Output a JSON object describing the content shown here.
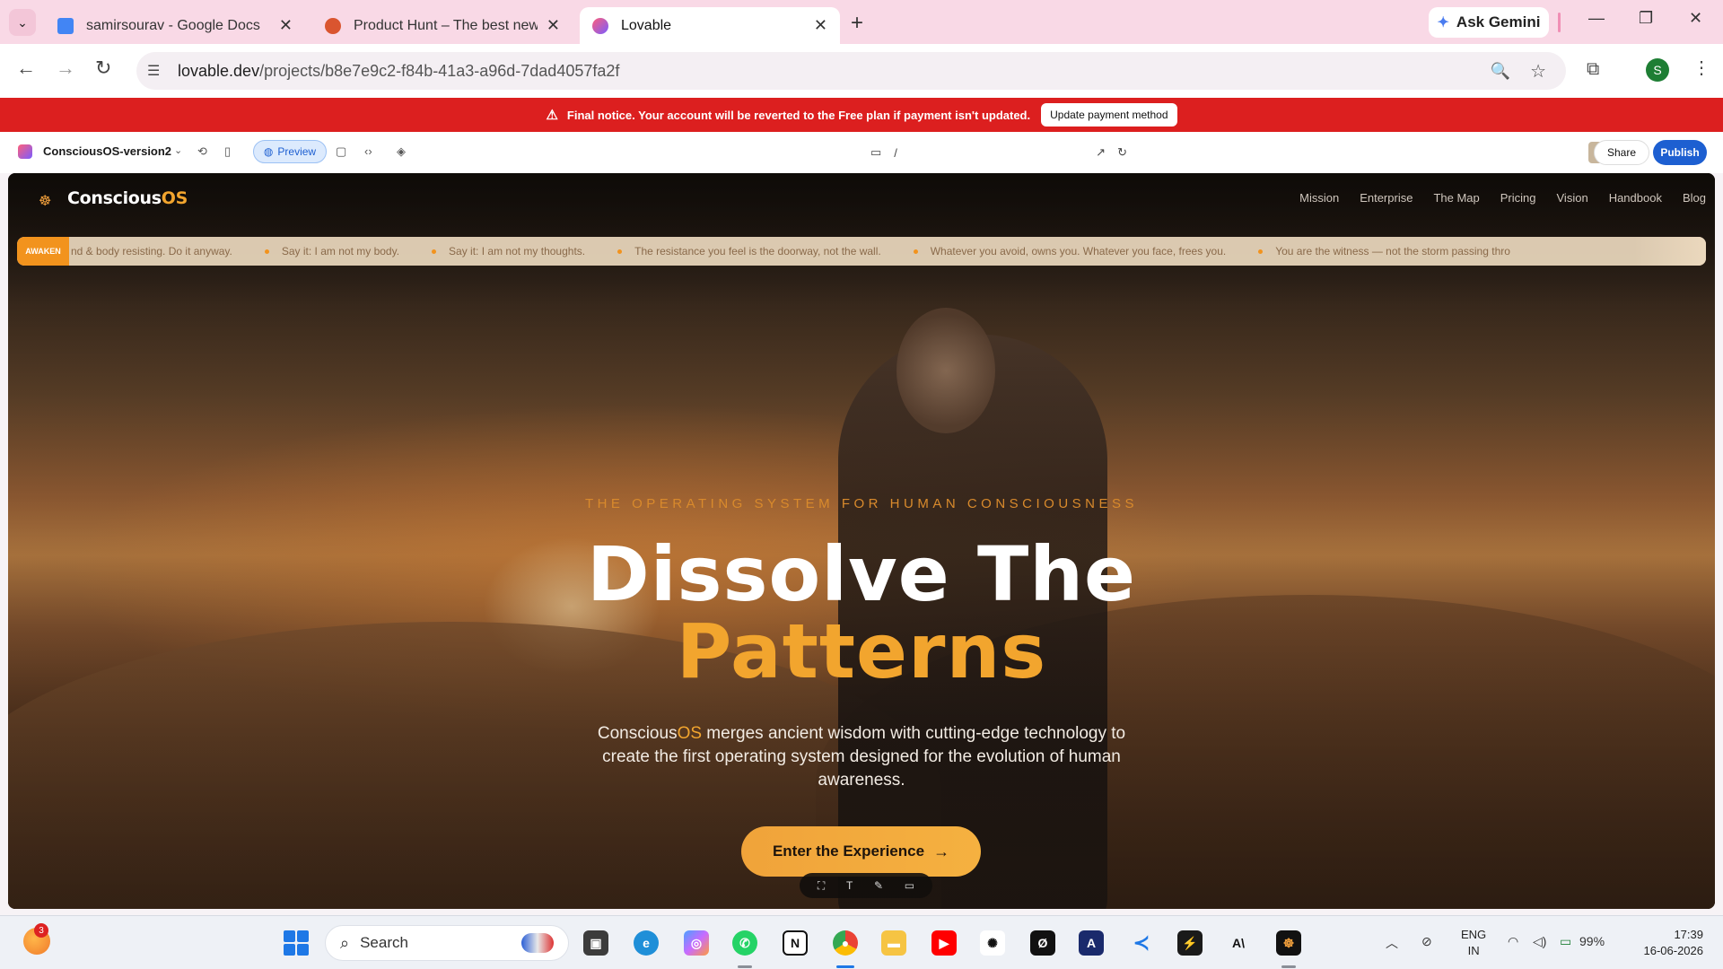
{
  "browser": {
    "tabs": [
      {
        "title": "samirsourav - Google Docs",
        "color": "#4285f4",
        "active": false
      },
      {
        "title": "Product Hunt – The best new p",
        "color": "#da552f",
        "active": false
      },
      {
        "title": "Lovable",
        "color": "#ff5f7a",
        "active": true
      }
    ],
    "new_tab": "+",
    "gemini_label": "Ask Gemini",
    "url_domain": "lovable.dev",
    "url_path": "/projects/b8e7e9c2-f84b-41a3-a96d-7dad4057fa2f",
    "profile_initial": "S"
  },
  "notice": {
    "text": "Final notice. Your account will be reverted to the Free plan if payment isn't updated.",
    "button": "Update payment method",
    "color": "#dc1f1f"
  },
  "lovable": {
    "project_name": "ConsciousOS-version2",
    "preview_label": "Preview",
    "route": "/",
    "share_label": "Share",
    "publish_label": "Publish",
    "accent": "#1d5fd1"
  },
  "site": {
    "logo_main": "Conscious",
    "logo_accent": "OS",
    "nav": [
      "Mission",
      "Enterprise",
      "The Map",
      "Pricing",
      "Vision",
      "Handbook",
      "Blog"
    ],
    "ticker_tag": "AWAKEN",
    "ticker": [
      "nd & body resisting. Do it anyway.",
      "Say it: I am not my body.",
      "Say it: I am not my thoughts.",
      "The resistance you feel is the doorway, not the wall.",
      "Whatever you avoid, owns you. Whatever you face, frees you.",
      "You are the witness — not the storm passing thro"
    ],
    "eyebrow": "THE OPERATING SYSTEM FOR HUMAN CONSCIOUSNESS",
    "headline_1": "Dissolve The",
    "headline_2": "Patterns",
    "sub_brand": "Conscious",
    "sub_brand_accent": "OS",
    "sub_rest": " merges ancient wisdom with cutting-edge technology to create the first operating system designed for the evolution of human awareness.",
    "cta": "Enter the Experience",
    "accent": "#f2a52e"
  },
  "taskbar": {
    "search_placeholder": "Search",
    "weather_badge": "3",
    "lang_line1": "ENG",
    "lang_line2": "IN",
    "battery": "99%",
    "time": "17:39",
    "date": "16-06-2026",
    "apps": [
      "file-explorer-dark",
      "edge",
      "copilot",
      "whatsapp",
      "notion",
      "chrome",
      "files",
      "youtube",
      "chatgpt",
      "perplexity",
      "app-a",
      "vscode",
      "supabase",
      "anthropic",
      "lovable-app"
    ]
  }
}
